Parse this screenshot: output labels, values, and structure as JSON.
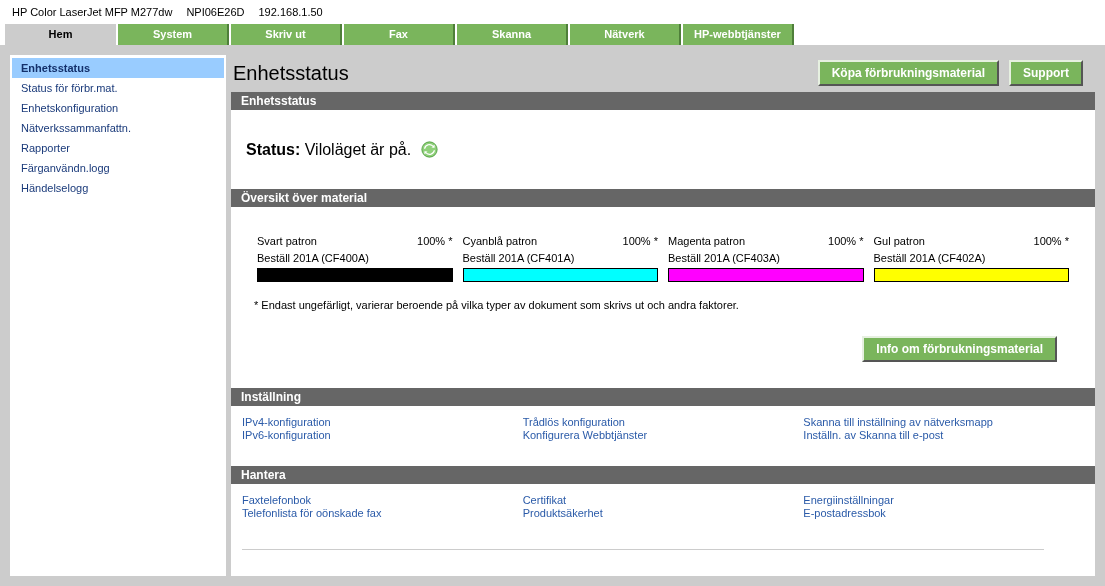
{
  "header": {
    "model": "HP Color LaserJet MFP M277dw",
    "hostname": "NPI06E26D",
    "ip": "192.168.1.50"
  },
  "tabs": [
    {
      "label": "Hem",
      "selected": true
    },
    {
      "label": "System",
      "selected": false
    },
    {
      "label": "Skriv ut",
      "selected": false
    },
    {
      "label": "Fax",
      "selected": false
    },
    {
      "label": "Skanna",
      "selected": false
    },
    {
      "label": "Nätverk",
      "selected": false
    },
    {
      "label": "HP-webbtjänster",
      "selected": false
    }
  ],
  "sidebar": {
    "items": [
      {
        "label": "Enhetsstatus",
        "selected": true
      },
      {
        "label": "Status för förbr.mat.",
        "selected": false
      },
      {
        "label": "Enhetskonfiguration",
        "selected": false
      },
      {
        "label": "Nätverkssammanfattn.",
        "selected": false
      },
      {
        "label": "Rapporter",
        "selected": false
      },
      {
        "label": "Färganvändn.logg",
        "selected": false
      },
      {
        "label": "Händelselogg",
        "selected": false
      }
    ]
  },
  "page_title": "Enhetsstatus",
  "top_buttons": [
    "Köpa förbrukningsmaterial",
    "Support"
  ],
  "status_section": {
    "heading": "Enhetsstatus",
    "label": "Status:",
    "value": "Viloläget är på."
  },
  "supplies_section": {
    "heading": "Översikt över material",
    "cartridges": [
      {
        "name": "Svart patron",
        "percent": "100% *",
        "order": "Beställ 201A (CF400A)",
        "color": "#000000",
        "level": 1
      },
      {
        "name": "Cyanblå patron",
        "percent": "100% *",
        "order": "Beställ 201A (CF401A)",
        "color": "#00ffff",
        "level": 1
      },
      {
        "name": "Magenta patron",
        "percent": "100% *",
        "order": "Beställ 201A (CF403A)",
        "color": "#ff00ff",
        "level": 1
      },
      {
        "name": "Gul patron",
        "percent": "100% *",
        "order": "Beställ 201A (CF402A)",
        "color": "#ffff00",
        "level": 1
      }
    ],
    "footnote": "* Endast ungefärligt, varierar beroende på vilka typer av dokument som skrivs ut och andra faktorer.",
    "button": "Info om förbrukningsmaterial"
  },
  "link_sections": [
    {
      "heading": "Inställning",
      "links": [
        "IPv4-konfiguration",
        "IPv6-konfiguration",
        "Trådlös konfiguration",
        "Konfigurera Webbtjänster",
        "Skanna till inställning av nätverksmapp",
        "Inställn. av Skanna till e-post"
      ]
    },
    {
      "heading": "Hantera",
      "links": [
        "Faxtelefonbok",
        "Telefonlista för oönskade fax",
        "Certifikat",
        "Produktsäkerhet",
        "Energiinställningar",
        "E-postadressbok"
      ]
    }
  ]
}
